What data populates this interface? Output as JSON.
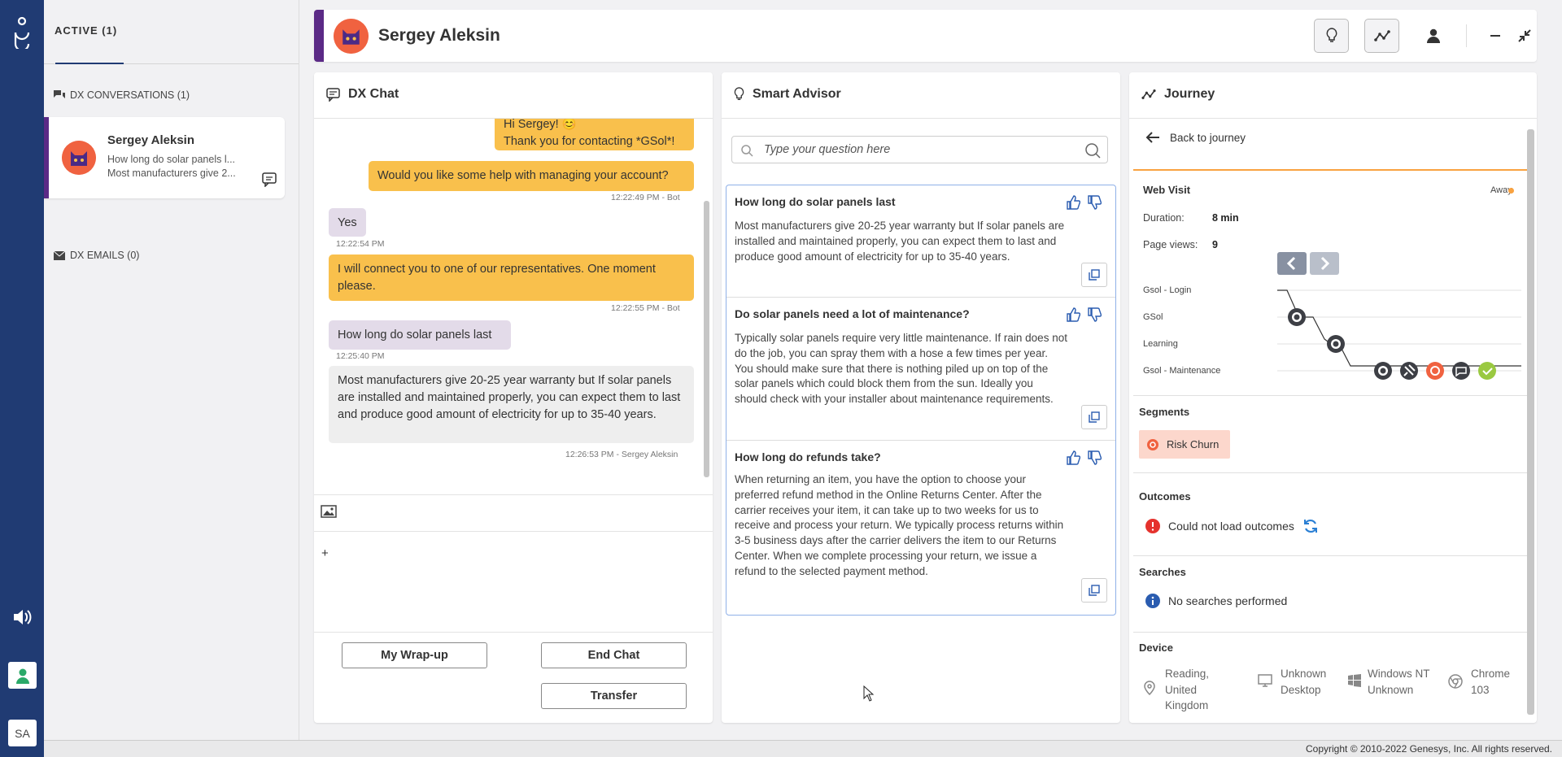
{
  "left": {
    "active_tab": "ACTIVE (1)",
    "dx_conversations": "DX CONVERSATIONS (1)",
    "dx_emails": "DX EMAILS (0)",
    "conversation": {
      "name": "Sergey Aleksin",
      "line1": "How long do solar panels l...",
      "line2": "Most manufacturers give 2..."
    }
  },
  "rail": {
    "initials": "SA"
  },
  "header": {
    "name": "Sergey Aleksin"
  },
  "chat": {
    "title": "DX Chat",
    "messages": [
      {
        "text1": "Hi Sergey! 😊",
        "text2": "Thank you for contacting *GSol*!"
      },
      {
        "text": "Would you like some help with managing your account?",
        "time": "12:22:49 PM - Bot"
      },
      {
        "text": "Yes",
        "time": "12:22:54 PM"
      },
      {
        "text": "I will connect you to one of our representatives. One moment please.",
        "time": "12:22:55 PM - Bot"
      },
      {
        "text": "How long do solar panels last",
        "time": "12:25:40 PM"
      },
      {
        "text": "Most manufacturers give 20-25 year warranty but If solar panels are installed and maintained properly, you can expect them to last and produce good amount of electricity for up to 35-40 years.",
        "time": "12:26:53 PM - Sergey Aleksin"
      }
    ],
    "plus": "+",
    "wrapup": "My Wrap-up",
    "end": "End Chat",
    "transfer": "Transfer"
  },
  "advisor": {
    "title": "Smart Advisor",
    "placeholder": "Type your question here",
    "cards": [
      {
        "q": "How long do solar panels last",
        "a": "Most manufacturers give 20-25 year warranty but If solar panels are installed and maintained properly, you can expect them to last and produce good amount of electricity for up to 35-40 years."
      },
      {
        "q": "Do solar panels need a lot of maintenance?",
        "a": "Typically solar panels require very little maintenance. If rain does not do the job, you can spray them with a hose a few times per year. You should make sure that there is nothing piled up on top of the solar panels which could block them from the sun. Ideally you should check with your installer about maintenance requirements."
      },
      {
        "q": "How long do refunds take?",
        "a": "When returning an item, you have the option to choose your preferred refund method in the Online Returns Center. After the carrier receives your item, it can take up to two weeks for us to receive and process your return. We typically process returns within 3-5 business days after the carrier delivers the item to our Returns Center. When we complete processing your return, we issue a refund to the selected payment method."
      }
    ]
  },
  "journey": {
    "title": "Journey",
    "back": "Back to journey",
    "visit": "Web Visit",
    "away": "Away",
    "duration_label": "Duration:",
    "duration": "8 min",
    "pageviews_label": "Page views:",
    "pageviews": "9",
    "rows": [
      "Gsol - Login",
      "GSol",
      "Learning",
      "Gsol - Maintenance"
    ],
    "segments": "Segments",
    "segment": "Risk Churn",
    "outcomes": "Outcomes",
    "outcomes_msg": "Could not load outcomes",
    "searches": "Searches",
    "searches_msg": "No searches performed",
    "device": "Device",
    "location": "Reading, United Kingdom",
    "device_type": "Unknown Desktop",
    "os": "Windows NT Unknown",
    "browser": "Chrome 103"
  },
  "footer": {
    "copyright": "Copyright © 2010-2022 Genesys, Inc. All rights reserved."
  },
  "colors": {
    "rail": "#203b73",
    "bot": "#f9c04c",
    "accent": "#5b2a86",
    "orange": "#f06240"
  }
}
